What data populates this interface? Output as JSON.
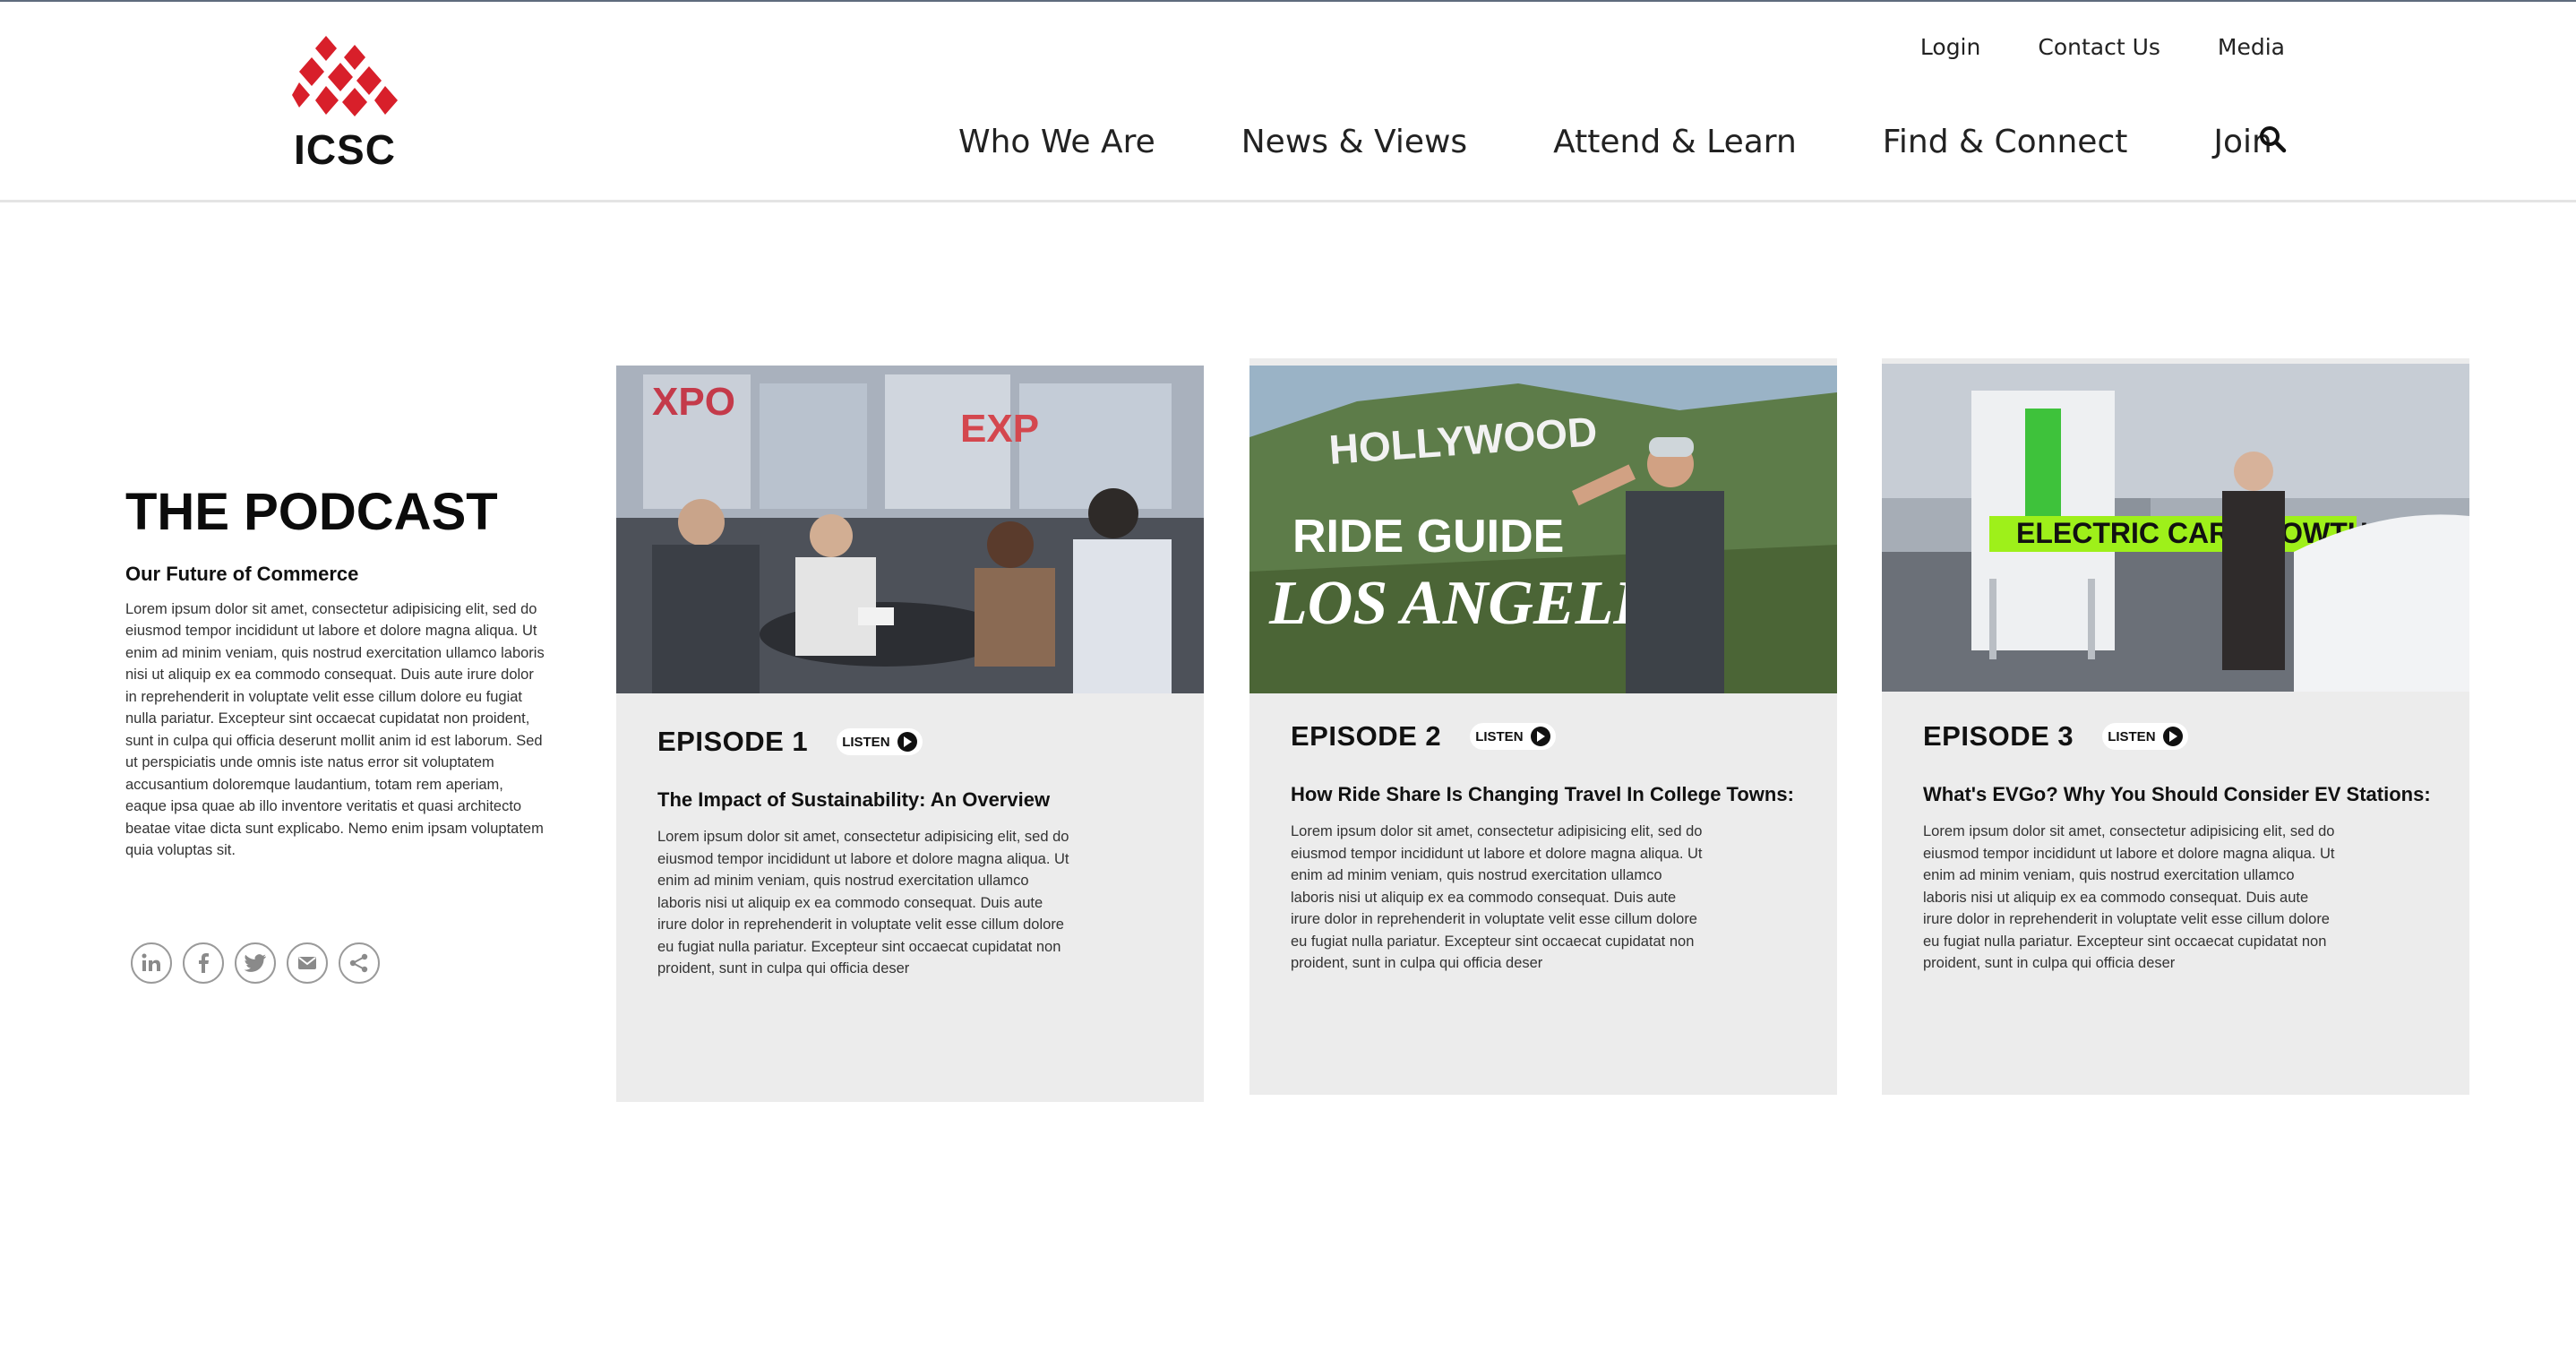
{
  "header": {
    "logo_text": "ICSC",
    "utility_nav": [
      "Login",
      "Contact Us",
      "Media"
    ],
    "main_nav": [
      "Who We Are",
      "News & Views",
      "Attend & Learn",
      "Find & Connect",
      "Join"
    ],
    "search_icon": "search-icon"
  },
  "intro": {
    "title": "THE PODCAST",
    "subtitle": "Our Future of Commerce",
    "body": "Lorem ipsum dolor sit amet, consectetur adipisicing elit, sed do eiusmod tempor incididunt ut labore et dolore magna aliqua. Ut enim ad minim veniam, quis nostrud exercitation ullamco laboris nisi ut aliquip ex ea commodo consequat. Duis aute irure dolor in reprehenderit in voluptate velit esse cillum dolore eu fugiat nulla pariatur. Excepteur sint occaecat cupidatat non proident, sunt in culpa qui officia deserunt mollit anim id est laborum. Sed ut perspiciatis unde omnis iste natus error sit voluptatem accusantium doloremque laudantium, totam rem aperiam, eaque ipsa quae ab illo inventore veritatis et quasi architecto beatae vitae dicta sunt explicabo. Nemo enim ipsam voluptatem quia voluptas sit.",
    "share_icons": [
      "linkedin-icon",
      "facebook-icon",
      "twitter-icon",
      "email-icon",
      "share-icon"
    ]
  },
  "episodes": [
    {
      "label": "EPISODE 1",
      "listen": "LISTEN",
      "title": "The Impact of Sustainability: An Overview",
      "description": "Lorem ipsum dolor sit amet, consectetur adipisicing elit, sed do eiusmod tempor incididunt ut labore et dolore magna aliqua. Ut enim ad minim veniam, quis nostrud exercitation ullamco laboris nisi ut aliquip ex ea commodo consequat. Duis aute irure dolor in reprehenderit in voluptate velit esse cillum dolore eu fugiat nulla pariatur. Excepteur sint occaecat cupidatat non proident, sunt in culpa qui officia deser",
      "image_text": [
        "XPO",
        "EXP"
      ]
    },
    {
      "label": "EPISODE 2",
      "listen": "LISTEN",
      "title": "How Ride Share Is Changing Travel In College Towns:",
      "description": "Lorem ipsum dolor sit amet, consectetur adipisicing elit, sed do eiusmod tempor incididunt ut labore et dolore magna aliqua. Ut enim ad minim veniam, quis nostrud exercitation ullamco laboris nisi ut aliquip ex ea commodo consequat. Duis aute irure dolor in reprehenderit in voluptate velit esse cillum dolore eu fugiat nulla pariatur. Excepteur sint occaecat cupidatat non proident, sunt in culpa qui officia deser",
      "image_text": [
        "HOLLYWOOD",
        "RIDE GUIDE",
        "LOS ANGELES"
      ]
    },
    {
      "label": "EPISODE 3",
      "listen": "LISTEN",
      "title": "What's EVGo? Why You Should Consider EV Stations:",
      "description": "Lorem ipsum dolor sit amet, consectetur adipisicing elit, sed do eiusmod tempor incididunt ut labore et dolore magna aliqua. Ut enim ad minim veniam, quis nostrud exercitation ullamco laboris nisi ut aliquip ex ea commodo consequat. Duis aute irure dolor in reprehenderit in voluptate velit esse cillum dolore eu fugiat nulla pariatur. Excepteur sint occaecat cupidatat non proident, sunt in culpa qui officia deser",
      "image_text": [
        "ELECTRIC CAR GROWTH"
      ]
    }
  ],
  "colors": {
    "brand_red": "#d81f2a",
    "card_bg": "#ececec",
    "ev_banner": "#9ef01a"
  }
}
